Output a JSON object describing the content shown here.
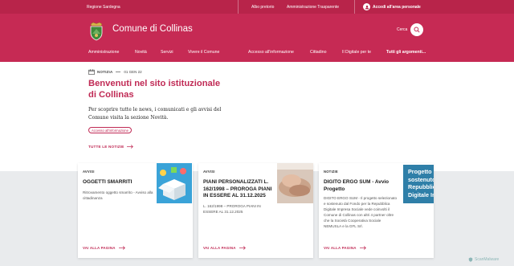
{
  "slimbar": {
    "region": "Regione Sardegna",
    "albo": "Albo pretorio",
    "trasparente": "Amministrazione Trasparente",
    "login": "Accedi all'area personale"
  },
  "header": {
    "title": "Comune di Collinas",
    "search_label": "Cerca"
  },
  "nav": {
    "left": [
      "Amministrazione",
      "Novità",
      "Servizi",
      "Vivere il Comune"
    ],
    "right": [
      "Accesso all'informazione",
      "Cittadino",
      "Il Digitale per te",
      "Tutti gli argomenti..."
    ]
  },
  "hero": {
    "tag": "NOTIZIA",
    "date": "01 GEN 22",
    "title": "Benvenuti nel sito istituzionale di Collinas",
    "text": "Per scoprire tutte le news, i comunicati e gli avvisi del Comune visita la sezione Novità.",
    "chip": "Accesso all'informazione",
    "all_link": "TUTTE LE NOTIZIE"
  },
  "cards": [
    {
      "category": "AVVISI",
      "title": "OGGETTI SMARRITI",
      "body": "Ritrovamento oggetto smarrito - Avviso alla cittadinanza",
      "link": "VAI ALLA PAGINA"
    },
    {
      "category": "AVVISI",
      "title": "PIANI PERSONALIZZATI L. 162/1998 – PROROGA PIANI IN ESSERE AL 31.12.2025",
      "body": "L. 162/1998 – PROROGA PIANI IN ESSERE AL 31.12.2025",
      "link": "VAI ALLA PAGINA"
    },
    {
      "category": "NOTIZIE",
      "title": "DIGITO ERGO SUM - Avvio Progetto",
      "body": "DIGITO ERGO SUM - Il progetto selezionato e sostenuto dal Fondo per la Repubblica Digitale Impresa Sociale vede coinvolti il Comune di Collinas con altri 4 partner oltre che la Società Cooperativa Sociale NEMUSLA e la GFL Srl.",
      "link": "VAI ALLA PAGINA",
      "thumb_text": "Progetto sostenuto da Repubblica Digitale Imp"
    }
  ],
  "watermark": "ScanMalware",
  "colors": {
    "brand": "#c62a54",
    "brand_dark": "#b8244a",
    "accent_text": "#c02a55",
    "gray_bg": "#e9ebed"
  }
}
